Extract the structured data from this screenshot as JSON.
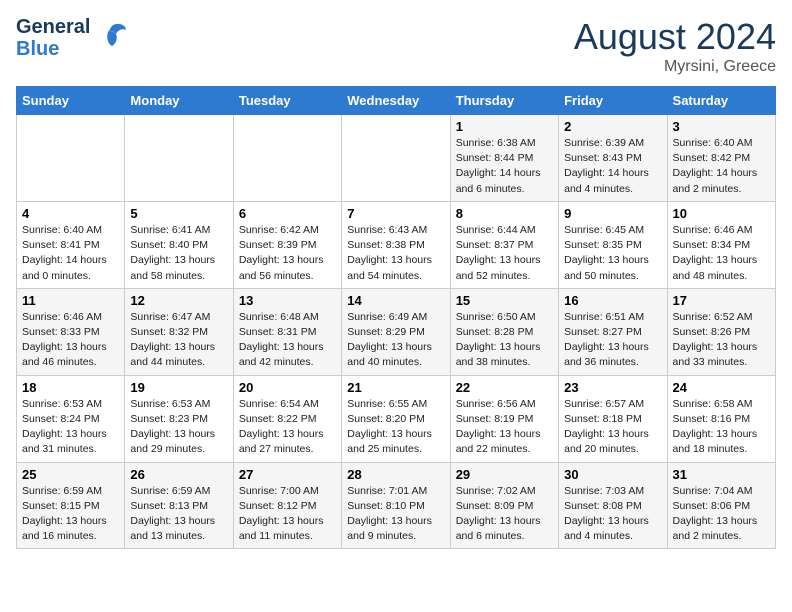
{
  "logo": {
    "line1": "General",
    "line2": "Blue"
  },
  "title": "August 2024",
  "location": "Myrsini, Greece",
  "days_of_week": [
    "Sunday",
    "Monday",
    "Tuesday",
    "Wednesday",
    "Thursday",
    "Friday",
    "Saturday"
  ],
  "weeks": [
    [
      {
        "day": "",
        "info": ""
      },
      {
        "day": "",
        "info": ""
      },
      {
        "day": "",
        "info": ""
      },
      {
        "day": "",
        "info": ""
      },
      {
        "day": "1",
        "info": "Sunrise: 6:38 AM\nSunset: 8:44 PM\nDaylight: 14 hours\nand 6 minutes."
      },
      {
        "day": "2",
        "info": "Sunrise: 6:39 AM\nSunset: 8:43 PM\nDaylight: 14 hours\nand 4 minutes."
      },
      {
        "day": "3",
        "info": "Sunrise: 6:40 AM\nSunset: 8:42 PM\nDaylight: 14 hours\nand 2 minutes."
      }
    ],
    [
      {
        "day": "4",
        "info": "Sunrise: 6:40 AM\nSunset: 8:41 PM\nDaylight: 14 hours\nand 0 minutes."
      },
      {
        "day": "5",
        "info": "Sunrise: 6:41 AM\nSunset: 8:40 PM\nDaylight: 13 hours\nand 58 minutes."
      },
      {
        "day": "6",
        "info": "Sunrise: 6:42 AM\nSunset: 8:39 PM\nDaylight: 13 hours\nand 56 minutes."
      },
      {
        "day": "7",
        "info": "Sunrise: 6:43 AM\nSunset: 8:38 PM\nDaylight: 13 hours\nand 54 minutes."
      },
      {
        "day": "8",
        "info": "Sunrise: 6:44 AM\nSunset: 8:37 PM\nDaylight: 13 hours\nand 52 minutes."
      },
      {
        "day": "9",
        "info": "Sunrise: 6:45 AM\nSunset: 8:35 PM\nDaylight: 13 hours\nand 50 minutes."
      },
      {
        "day": "10",
        "info": "Sunrise: 6:46 AM\nSunset: 8:34 PM\nDaylight: 13 hours\nand 48 minutes."
      }
    ],
    [
      {
        "day": "11",
        "info": "Sunrise: 6:46 AM\nSunset: 8:33 PM\nDaylight: 13 hours\nand 46 minutes."
      },
      {
        "day": "12",
        "info": "Sunrise: 6:47 AM\nSunset: 8:32 PM\nDaylight: 13 hours\nand 44 minutes."
      },
      {
        "day": "13",
        "info": "Sunrise: 6:48 AM\nSunset: 8:31 PM\nDaylight: 13 hours\nand 42 minutes."
      },
      {
        "day": "14",
        "info": "Sunrise: 6:49 AM\nSunset: 8:29 PM\nDaylight: 13 hours\nand 40 minutes."
      },
      {
        "day": "15",
        "info": "Sunrise: 6:50 AM\nSunset: 8:28 PM\nDaylight: 13 hours\nand 38 minutes."
      },
      {
        "day": "16",
        "info": "Sunrise: 6:51 AM\nSunset: 8:27 PM\nDaylight: 13 hours\nand 36 minutes."
      },
      {
        "day": "17",
        "info": "Sunrise: 6:52 AM\nSunset: 8:26 PM\nDaylight: 13 hours\nand 33 minutes."
      }
    ],
    [
      {
        "day": "18",
        "info": "Sunrise: 6:53 AM\nSunset: 8:24 PM\nDaylight: 13 hours\nand 31 minutes."
      },
      {
        "day": "19",
        "info": "Sunrise: 6:53 AM\nSunset: 8:23 PM\nDaylight: 13 hours\nand 29 minutes."
      },
      {
        "day": "20",
        "info": "Sunrise: 6:54 AM\nSunset: 8:22 PM\nDaylight: 13 hours\nand 27 minutes."
      },
      {
        "day": "21",
        "info": "Sunrise: 6:55 AM\nSunset: 8:20 PM\nDaylight: 13 hours\nand 25 minutes."
      },
      {
        "day": "22",
        "info": "Sunrise: 6:56 AM\nSunset: 8:19 PM\nDaylight: 13 hours\nand 22 minutes."
      },
      {
        "day": "23",
        "info": "Sunrise: 6:57 AM\nSunset: 8:18 PM\nDaylight: 13 hours\nand 20 minutes."
      },
      {
        "day": "24",
        "info": "Sunrise: 6:58 AM\nSunset: 8:16 PM\nDaylight: 13 hours\nand 18 minutes."
      }
    ],
    [
      {
        "day": "25",
        "info": "Sunrise: 6:59 AM\nSunset: 8:15 PM\nDaylight: 13 hours\nand 16 minutes."
      },
      {
        "day": "26",
        "info": "Sunrise: 6:59 AM\nSunset: 8:13 PM\nDaylight: 13 hours\nand 13 minutes."
      },
      {
        "day": "27",
        "info": "Sunrise: 7:00 AM\nSunset: 8:12 PM\nDaylight: 13 hours\nand 11 minutes."
      },
      {
        "day": "28",
        "info": "Sunrise: 7:01 AM\nSunset: 8:10 PM\nDaylight: 13 hours\nand 9 minutes."
      },
      {
        "day": "29",
        "info": "Sunrise: 7:02 AM\nSunset: 8:09 PM\nDaylight: 13 hours\nand 6 minutes."
      },
      {
        "day": "30",
        "info": "Sunrise: 7:03 AM\nSunset: 8:08 PM\nDaylight: 13 hours\nand 4 minutes."
      },
      {
        "day": "31",
        "info": "Sunrise: 7:04 AM\nSunset: 8:06 PM\nDaylight: 13 hours\nand 2 minutes."
      }
    ]
  ]
}
